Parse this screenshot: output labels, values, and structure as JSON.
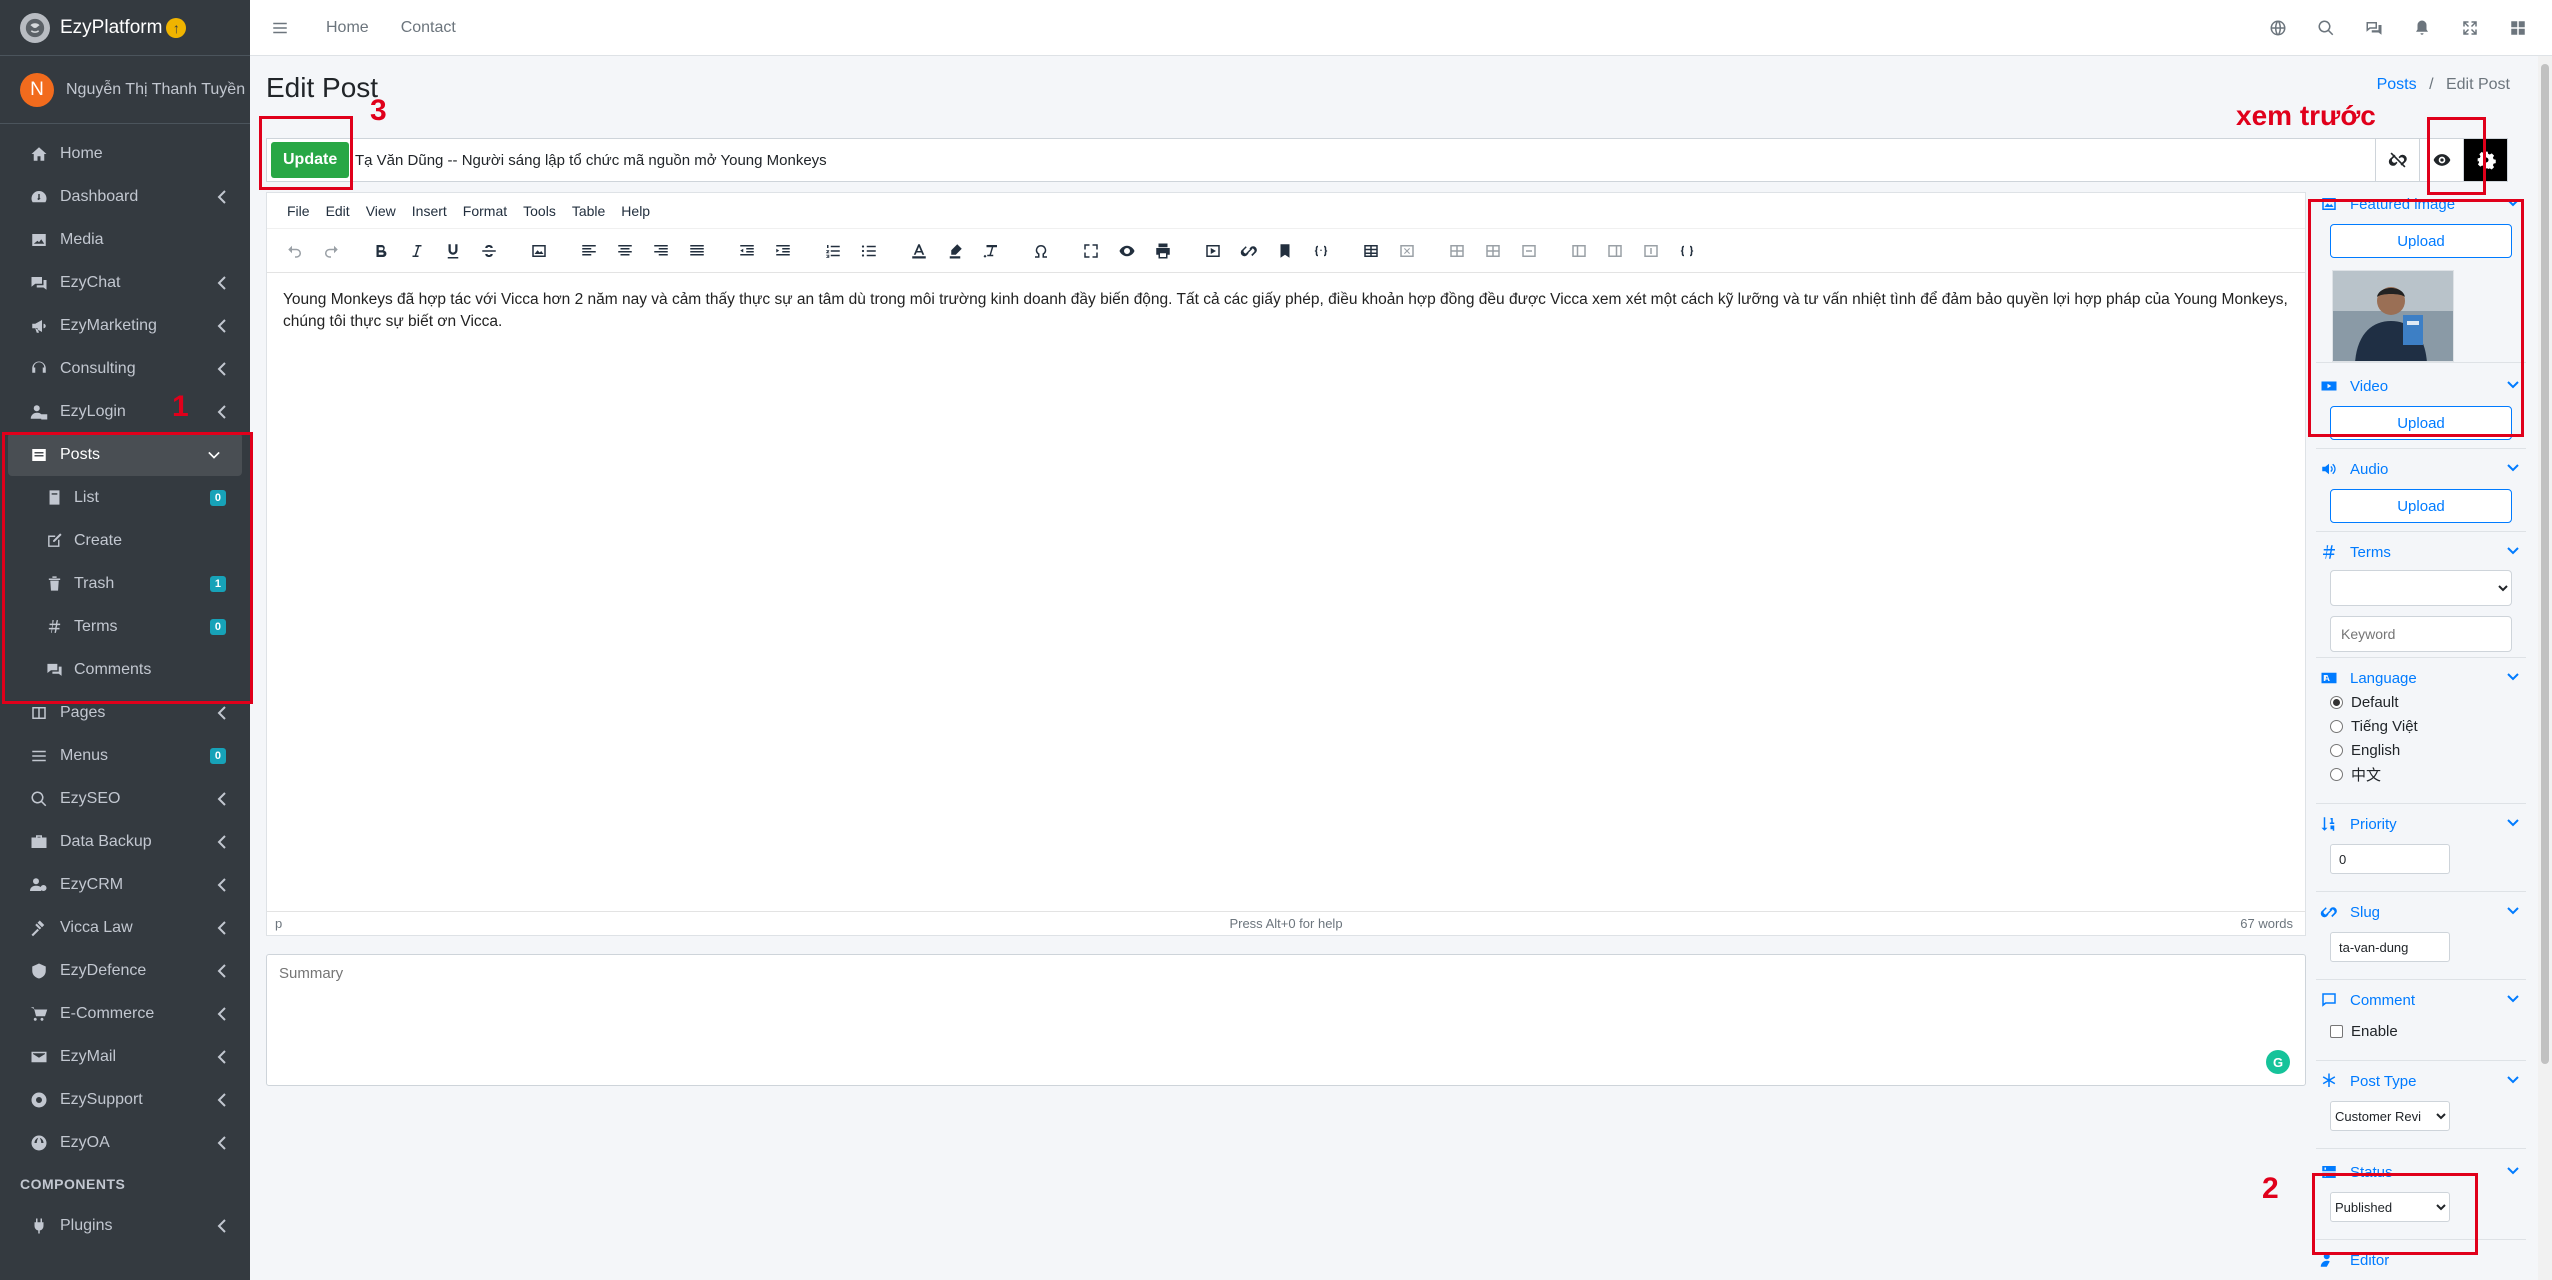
{
  "brand": {
    "name": "EzyPlatform",
    "upgrade_icon": "arrow-up-circle-icon"
  },
  "user": {
    "initial": "N",
    "name": "Nguyễn Thị Thanh Tuyền"
  },
  "sidebar": {
    "items": [
      {
        "label": "Home",
        "icon": "home-icon"
      },
      {
        "label": "Dashboard",
        "icon": "dashboard-icon"
      },
      {
        "label": "Media",
        "icon": "image-icon"
      },
      {
        "label": "EzyChat",
        "icon": "chat-icon"
      },
      {
        "label": "EzyMarketing",
        "icon": "megaphone-icon"
      },
      {
        "label": "Consulting",
        "icon": "consulting-icon"
      },
      {
        "label": "EzyLogin",
        "icon": "user-lock-icon"
      },
      {
        "label": "Posts",
        "icon": "posts-icon"
      }
    ],
    "posts_sub": [
      {
        "label": "List",
        "badge": "0"
      },
      {
        "label": "Create",
        "badge": ""
      },
      {
        "label": "Trash",
        "badge": "1"
      },
      {
        "label": "Terms",
        "badge": "0"
      },
      {
        "label": "Comments",
        "badge": ""
      }
    ],
    "items2": [
      {
        "label": "Pages",
        "badge": ""
      },
      {
        "label": "Menus",
        "badge": "0"
      },
      {
        "label": "EzySEO",
        "badge": ""
      },
      {
        "label": "Data Backup",
        "badge": ""
      },
      {
        "label": "EzyCRM",
        "badge": ""
      },
      {
        "label": "Vicca Law",
        "badge": ""
      },
      {
        "label": "EzyDefence",
        "badge": ""
      },
      {
        "label": "E-Commerce",
        "badge": ""
      },
      {
        "label": "EzyMail",
        "badge": ""
      },
      {
        "label": "EzySupport",
        "badge": ""
      },
      {
        "label": "EzyOA",
        "badge": ""
      }
    ],
    "components_header": "COMPONENTS",
    "plugins": "Plugins"
  },
  "topbar": {
    "home": "Home",
    "contact": "Contact"
  },
  "page": {
    "title": "Edit Post",
    "breadcrumb_posts": "Posts",
    "breadcrumb_sep": "/",
    "breadcrumb_current": "Edit Post"
  },
  "post": {
    "update_label": "Update",
    "title_value": "Tạ Văn Dũng -- Người sáng lập tổ chức mã nguồn mở Young Monkeys",
    "body": "Young Monkeys đã hợp tác với Vicca hơn 2 năm nay và cảm thấy thực sự an tâm dù trong môi trường kinh doanh đầy biến động. Tất cả các giấy phép, điều khoản hợp đồng đều được Vicca xem xét một cách kỹ lưỡng và tư vấn nhiệt tình để đảm bảo quyền lợi hợp pháp của Young Monkeys, chúng tôi thực sự biết ơn Vicca.",
    "summary_placeholder": "Summary"
  },
  "editor": {
    "menus": [
      "File",
      "Edit",
      "View",
      "Insert",
      "Format",
      "Tools",
      "Table",
      "Help"
    ],
    "status_path": "p",
    "status_help": "Press Alt+0 for help",
    "status_words": "67 words"
  },
  "right": {
    "featured_image": "Featured image",
    "video": "Video",
    "audio": "Audio",
    "upload": "Upload",
    "terms": "Terms",
    "keyword_placeholder": "Keyword",
    "language": "Language",
    "languages": [
      "Default",
      "Tiếng Việt",
      "English",
      "中文"
    ],
    "priority": "Priority",
    "priority_value": "0",
    "slug": "Slug",
    "slug_value": "ta-van-dung",
    "comment": "Comment",
    "enable": "Enable",
    "post_type": "Post Type",
    "post_type_value": "Customer Revi",
    "status": "Status",
    "status_value": "Published",
    "editor": "Editor"
  },
  "annotations": {
    "n1": "1",
    "n2": "2",
    "n3": "3",
    "preview": "xem trước"
  },
  "colors": {
    "accent": "#007bff",
    "update": "#28a745",
    "annotation": "#e0001b",
    "sidebar": "#343a40"
  }
}
